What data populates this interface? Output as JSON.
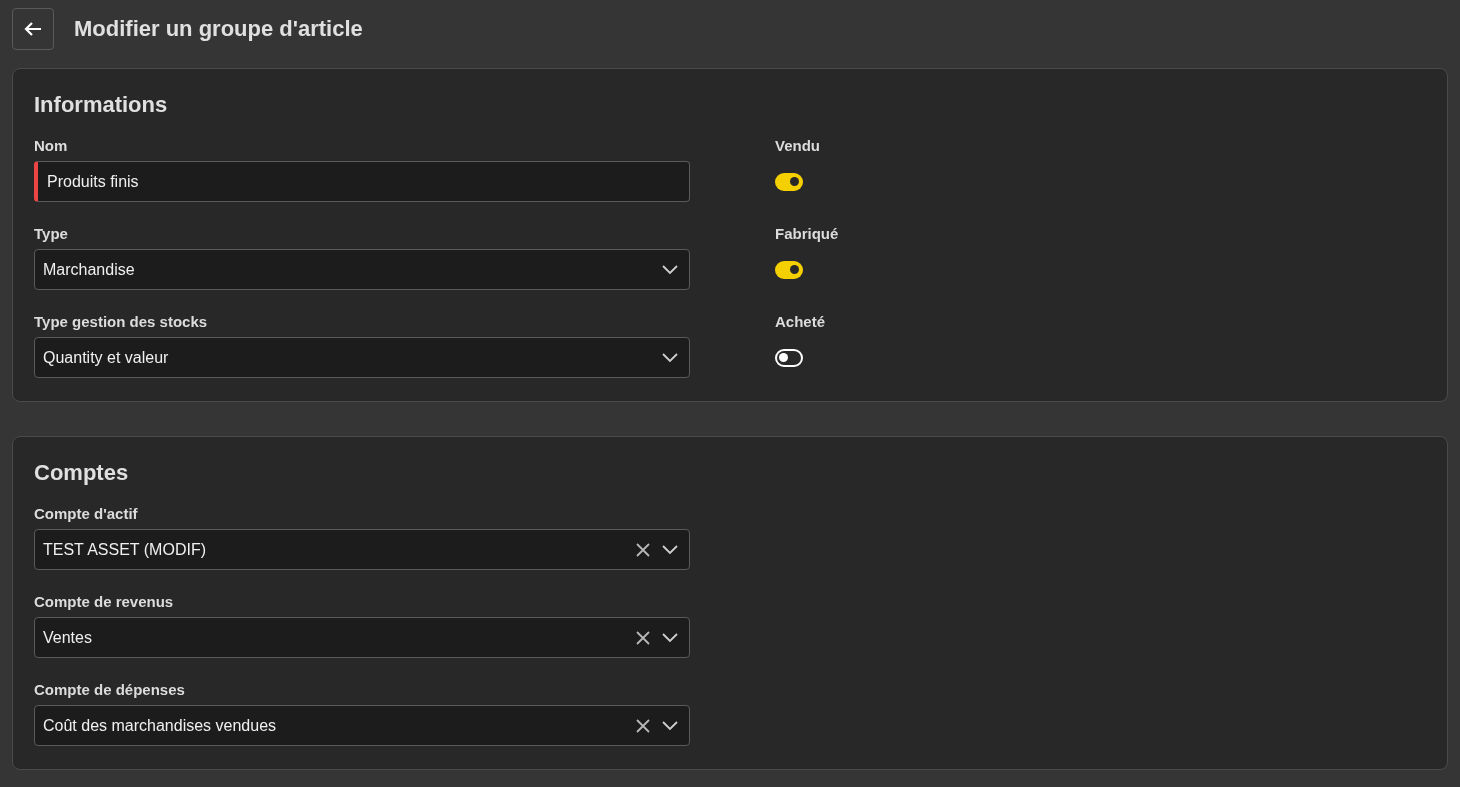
{
  "header": {
    "title": "Modifier un groupe d'article"
  },
  "sections": [
    {
      "title": "Informations",
      "fields": [
        {
          "label": "Nom",
          "kind": "text",
          "value": "Produits finis",
          "invalid": true
        },
        {
          "label": "Type",
          "kind": "select",
          "value": "Marchandise"
        },
        {
          "label": "Type gestion des stocks",
          "kind": "select",
          "value": "Quantity et valeur"
        }
      ],
      "toggles": [
        {
          "label": "Vendu",
          "on": true
        },
        {
          "label": "Fabriqué",
          "on": true
        },
        {
          "label": "Acheté",
          "on": false
        }
      ]
    },
    {
      "title": "Comptes",
      "fields": [
        {
          "label": "Compte d'actif",
          "kind": "clearable-select",
          "value": "TEST ASSET (MODIF)"
        },
        {
          "label": "Compte de revenus",
          "kind": "clearable-select",
          "value": "Ventes"
        },
        {
          "label": "Compte de dépenses",
          "kind": "clearable-select",
          "value": "Coût des marchandises vendues"
        }
      ]
    }
  ]
}
